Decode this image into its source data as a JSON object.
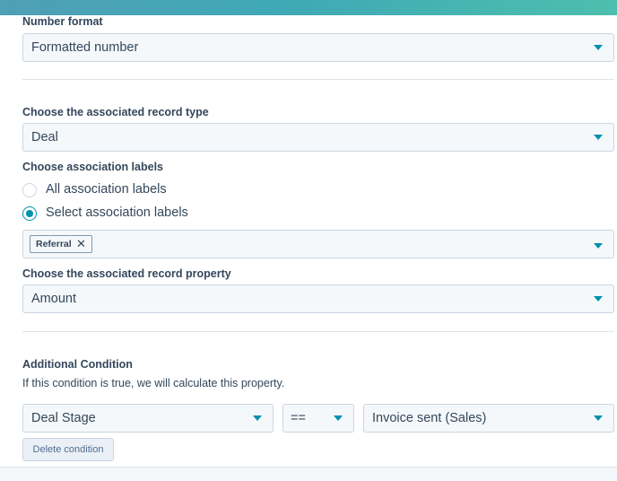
{
  "number_format": {
    "label": "Number format",
    "value": "Formatted number"
  },
  "record_type": {
    "label": "Choose the associated record type",
    "value": "Deal"
  },
  "association_labels": {
    "label": "Choose association labels",
    "options": [
      {
        "label": "All association labels",
        "checked": false
      },
      {
        "label": "Select association labels",
        "checked": true
      }
    ],
    "selected_tags": [
      {
        "label": "Referral",
        "remove_glyph": "✕"
      }
    ]
  },
  "record_property": {
    "label": "Choose the associated record property",
    "value": "Amount"
  },
  "additional_condition": {
    "label": "Additional Condition",
    "description": "If this condition is true, we will calculate this property.",
    "field": "Deal Stage",
    "operator": "==",
    "value": "Invoice sent (Sales)",
    "delete_label": "Delete condition"
  },
  "colors": {
    "accent": "#0091ae",
    "text": "#33475b",
    "input_bg": "#f5f8fa",
    "border": "#cbd6e2"
  },
  "icons": {
    "dropdown": "caret-down-icon",
    "tag_remove": "close-icon"
  }
}
